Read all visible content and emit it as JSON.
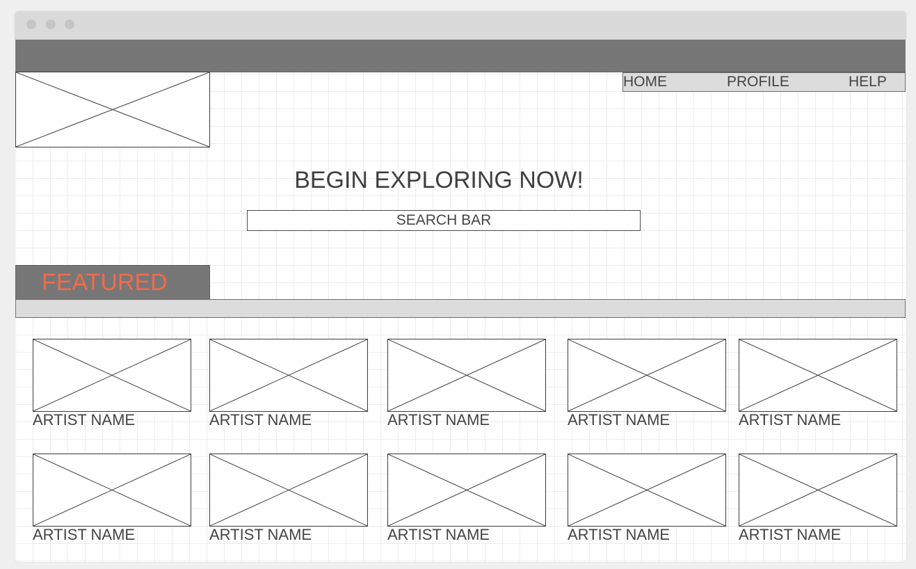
{
  "nav": {
    "home": "HOME",
    "profile": "PROFILE",
    "help": "HELP"
  },
  "hero": {
    "title": "BEGIN EXPLORING NOW!",
    "search_placeholder": "SEARCH BAR"
  },
  "featured": {
    "label": "FEATURED"
  },
  "artists": {
    "row1": [
      "ARTIST NAME",
      "ARTIST NAME",
      "ARTIST NAME",
      "ARTIST NAME",
      "ARTIST NAME"
    ],
    "row2": [
      "ARTIST NAME",
      "ARTIST NAME",
      "ARTIST NAME",
      "ARTIST NAME",
      "ARTIST NAME"
    ]
  },
  "colors": {
    "accent": "#f26b4b",
    "header_bar": "#777777",
    "nav_bar": "#dcdcdc"
  },
  "icons": {
    "logo": "image-placeholder-icon",
    "artist_thumbnail": "image-placeholder-icon"
  }
}
